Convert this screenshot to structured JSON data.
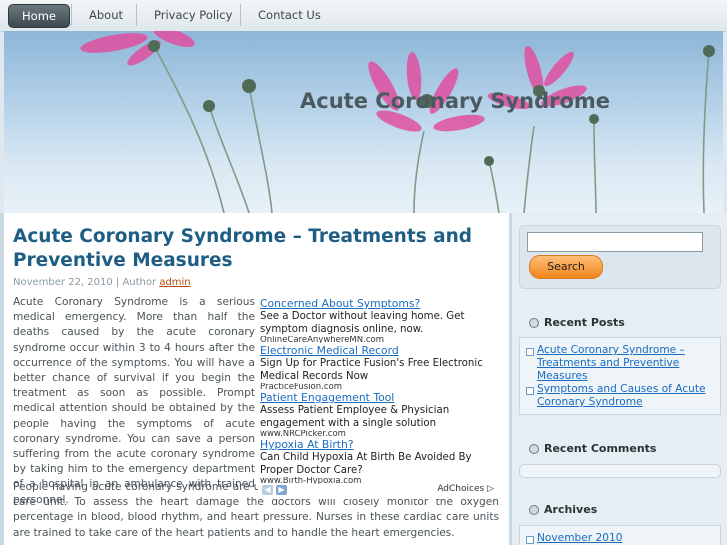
{
  "nav": {
    "home": "Home",
    "about": "About",
    "privacy": "Privacy Policy",
    "contact": "Contact Us"
  },
  "site_title": "Acute Coronary Syndrome",
  "post": {
    "title": "Acute Coronary Syndrome – Treatments and Preventive Measures",
    "date_text": "November 22, 2010 | Author",
    "author": "admin",
    "paragraph1": "Acute Coronary Syndrome is a serious medical emergency. More than half the deaths caused by the acute coronary syndrome occur within 3 to 4 hours after the occurrence of the symptoms. You will have a better chance of survival if you begin the treatment as soon as possible. Prompt medical attention should be obtained by the people having the symptoms of acute coronary syndrome. You can save a person suffering from the acute coronary syndrome by taking him to the emergency department of a hospital in an ambulance with trained personnel.",
    "paragraph2": "People having acute coronary syndrome are usually taken to a hospital having the cardiac care unit. To assess the heart damage the doctors will closely monitor the oxygen percentage in blood, blood rhythm, and heart pressure. Nurses in these cardiac care units are trained to take care of the heart patients and to handle the heart emergencies."
  },
  "ads": [
    {
      "title": "Concerned About Symptoms?",
      "desc": "See a Doctor without leaving home. Get symptom diagnosis online, now.",
      "url": "OnlineCareAnywhereMN.com"
    },
    {
      "title": "Electronic Medical Record",
      "desc": "Sign Up for Practice Fusion's Free Electronic Medical Records Now",
      "url": "PracticeFusion.com"
    },
    {
      "title": "Patient Engagement Tool",
      "desc": "Assess Patient Employee & Physician engagement with a single solution",
      "url": "www.NRCPicker.com"
    },
    {
      "title": "Hypoxia At Birth?",
      "desc": "Can Child Hypoxia At Birth Be Avoided By Proper Doctor Care?",
      "url": "www.Birth-Hypoxia.com"
    }
  ],
  "ad_choices": "AdChoices",
  "sidebar": {
    "search_button": "Search",
    "search_value": "",
    "recent_posts_title": "Recent Posts",
    "recent_posts": [
      "Acute Coronary Syndrome – Treatments and Preventive Measures",
      "Symptoms and Causes of Acute Coronary Syndrome"
    ],
    "recent_comments_title": "Recent Comments",
    "archives_title": "Archives",
    "archives": [
      "November 2010"
    ]
  }
}
